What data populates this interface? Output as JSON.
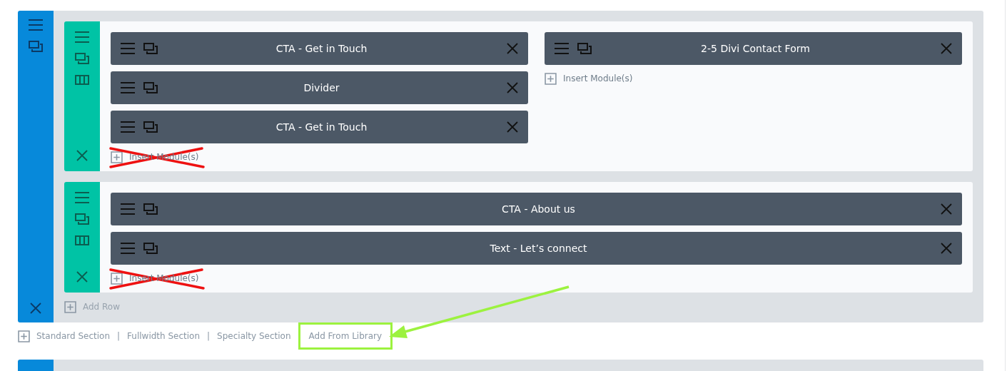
{
  "sections": [
    {
      "rows": [
        {
          "columns": [
            {
              "modules": [
                {
                  "title": "CTA - Get in Touch"
                },
                {
                  "title": "Divider"
                },
                {
                  "title": "CTA - Get in Touch"
                }
              ],
              "insert": {
                "label": "Insert Module(s)",
                "crossed_out": true
              }
            },
            {
              "modules": [
                {
                  "title": "2-5 Divi Contact Form"
                }
              ],
              "insert": {
                "label": "Insert Module(s)",
                "crossed_out": false
              }
            }
          ]
        },
        {
          "columns": [
            {
              "modules": [
                {
                  "title": "CTA - About us"
                },
                {
                  "title": "Text - Let’s connect"
                }
              ],
              "insert": {
                "label": "Insert Module(s)",
                "crossed_out": true
              }
            }
          ]
        }
      ],
      "add_row": "Add Row"
    }
  ],
  "section_bar": {
    "items": [
      {
        "label": "Standard Section",
        "highlighted": false
      },
      {
        "label": "Fullwidth Section",
        "highlighted": false
      },
      {
        "label": "Specialty Section",
        "highlighted": false
      },
      {
        "label": "Add From Library",
        "highlighted": true
      }
    ],
    "separator": "|"
  }
}
